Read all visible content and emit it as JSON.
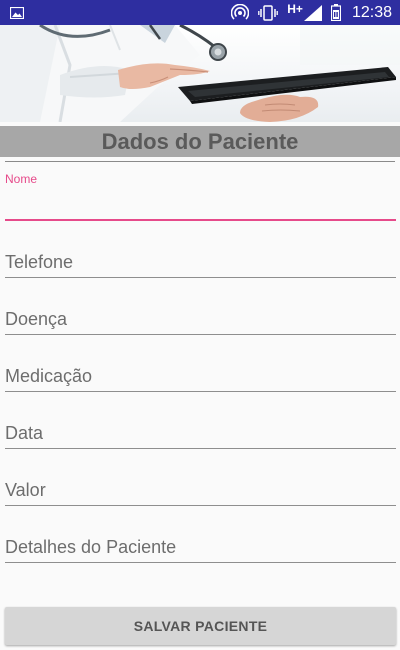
{
  "status_bar": {
    "network_type": "H+",
    "time": "12:38",
    "icons": [
      "image-notification-icon",
      "hotspot-icon",
      "vibrate-icon",
      "signal-icon",
      "battery-icon"
    ]
  },
  "form": {
    "title": "Dados do Paciente",
    "fields": [
      {
        "name": "nome",
        "label": "Nome",
        "value": "",
        "active": true
      },
      {
        "name": "telefone",
        "placeholder": "Telefone",
        "value": ""
      },
      {
        "name": "doenca",
        "placeholder": "Doença",
        "value": ""
      },
      {
        "name": "medicacao",
        "placeholder": "Medicação",
        "value": ""
      },
      {
        "name": "data",
        "placeholder": "Data",
        "value": ""
      },
      {
        "name": "valor",
        "placeholder": "Valor",
        "value": ""
      },
      {
        "name": "detalhes",
        "placeholder": "Detalhes do Paciente",
        "value": ""
      }
    ],
    "save_label": "SALVAR PACIENTE"
  },
  "colors": {
    "status_bar": "#2e2ea0",
    "accent": "#e64a8a",
    "title_band": "#a7a7a7",
    "button": "#d6d6d6"
  }
}
